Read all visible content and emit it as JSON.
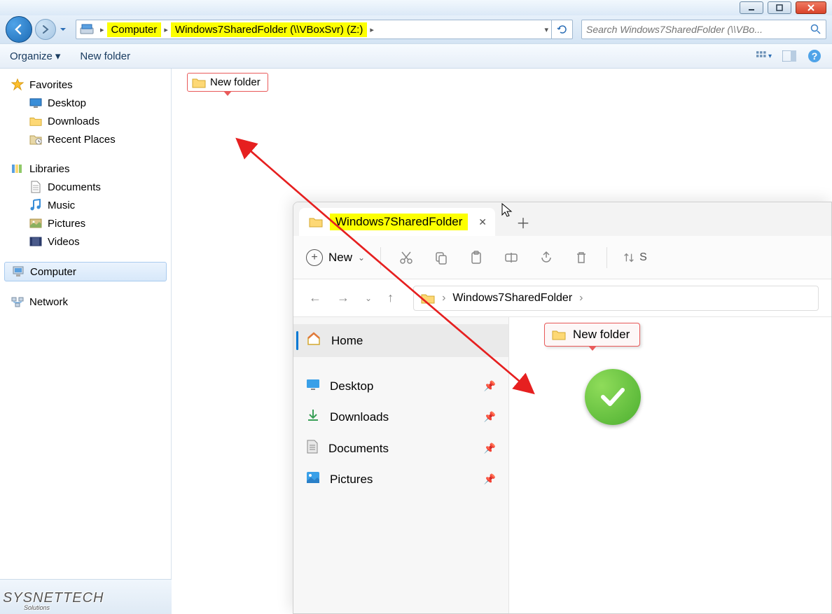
{
  "win7": {
    "breadcrumb": {
      "computer": "Computer",
      "drive": "Windows7SharedFolder (\\\\VBoxSvr) (Z:)"
    },
    "search_placeholder": "Search Windows7SharedFolder (\\\\VBo...",
    "toolbar": {
      "organize": "Organize",
      "newfolder": "New folder"
    },
    "sidebar": {
      "favorites": {
        "label": "Favorites",
        "items": [
          "Desktop",
          "Downloads",
          "Recent Places"
        ]
      },
      "libraries": {
        "label": "Libraries",
        "items": [
          "Documents",
          "Music",
          "Pictures",
          "Videos"
        ]
      },
      "computer": {
        "label": "Computer"
      },
      "network": {
        "label": "Network"
      }
    },
    "content": {
      "newfolder": "New folder"
    }
  },
  "win11": {
    "tab_title": "Windows7SharedFolder",
    "toolbar": {
      "new": "New",
      "sort": "S"
    },
    "breadcrumb": "Windows7SharedFolder",
    "sidebar": {
      "home": "Home",
      "items": [
        "Desktop",
        "Downloads",
        "Documents",
        "Pictures"
      ]
    },
    "content": {
      "newfolder": "New folder"
    }
  },
  "watermark": {
    "main": "SYSNETTECH",
    "sub": "Solutions"
  }
}
